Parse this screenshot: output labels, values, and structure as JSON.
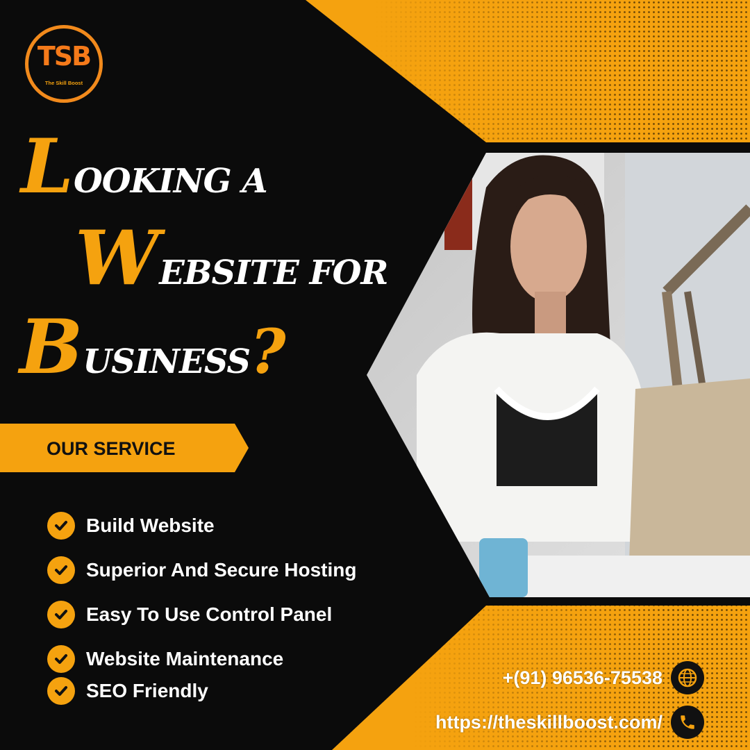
{
  "brand": {
    "logo_mark": "TSB",
    "logo_sub": "The Skill Boost"
  },
  "headline": {
    "line1_cap": "L",
    "line1_rest": "OOKING A",
    "line2_cap": "W",
    "line2_rest": "EBSITE FOR",
    "line3_cap": "B",
    "line3_rest": "USINESS",
    "question": "?"
  },
  "section_label": "OUR SERVICE",
  "services": [
    "Build Website",
    "Superior And Secure Hosting",
    "Easy To Use Control Panel",
    "Website Maintenance",
    "SEO Friendly"
  ],
  "contact": {
    "phone": "+(91) 96536-75538",
    "website": "https://theskillboost.com/"
  },
  "colors": {
    "accent": "#f5a20f",
    "background": "#0b0b0b",
    "text": "#ffffff"
  }
}
